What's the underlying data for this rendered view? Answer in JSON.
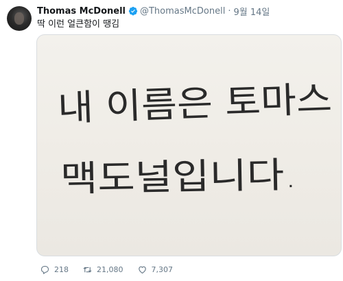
{
  "tweet": {
    "author_name": "Thomas McDonell",
    "handle": "@ThomasMcDonell",
    "separator": "·",
    "date": "9월 14일",
    "text": "딱 이런 얼큰함이 땡김",
    "media": {
      "handwritten_line1": "내 이름은 토마스",
      "handwritten_line2": "맥도널입니다."
    },
    "actions": {
      "replies": "218",
      "retweets": "21,080",
      "likes": "7,307"
    }
  },
  "colors": {
    "verified_blue": "#1da1f2",
    "text_primary": "#14171a",
    "text_secondary": "#657786",
    "paper": "#f1efe9",
    "ink": "#2a2a2a"
  },
  "icons": [
    "verified-icon",
    "reply-icon",
    "retweet-icon",
    "like-icon"
  ]
}
